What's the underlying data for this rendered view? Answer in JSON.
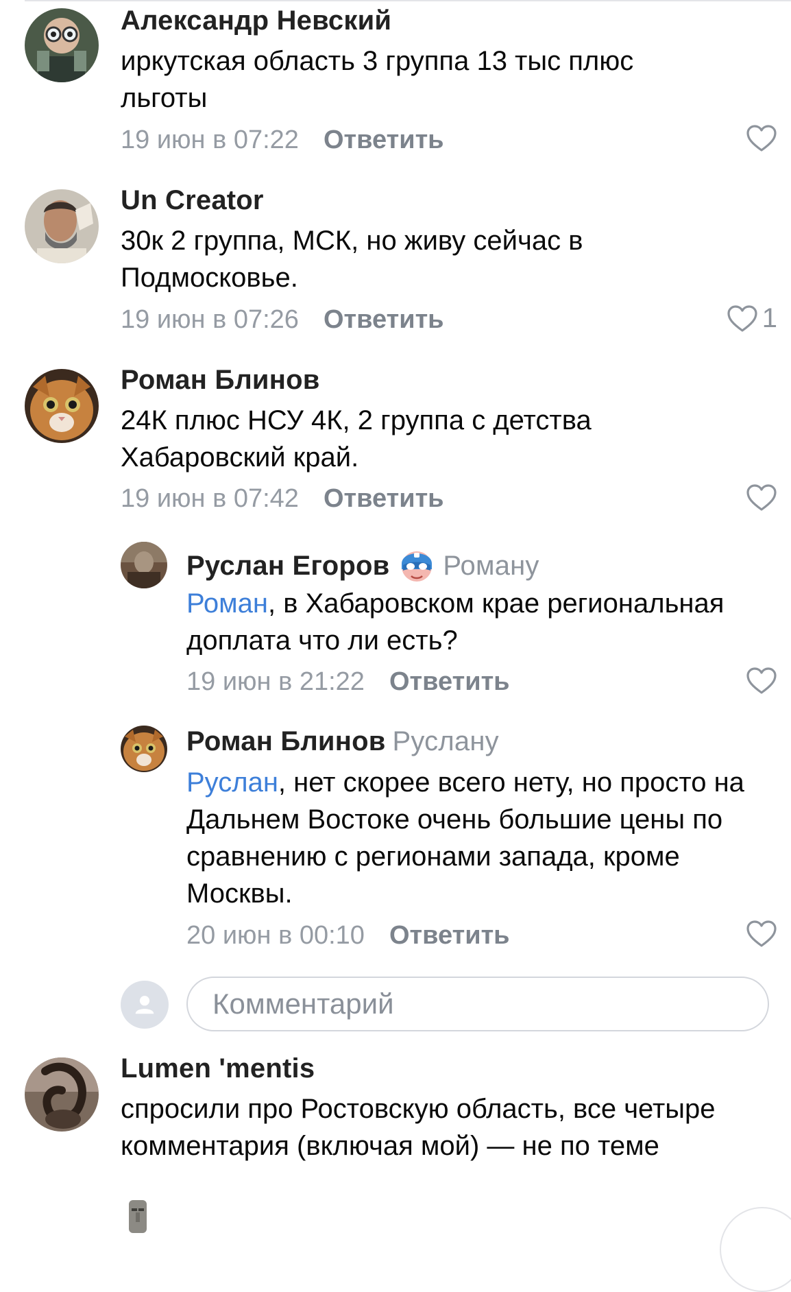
{
  "comments": [
    {
      "author": "Александр Невский",
      "text": "иркутская область 3 группа 13 тыс плюс льготы",
      "time": "19 июн в 07:22",
      "reply_label": "Ответить",
      "likes": ""
    },
    {
      "author": "Un Creator",
      "text": "30к  2 группа, МСК, но живу сейчас в Подмосковье.",
      "time": "19 июн в 07:26",
      "reply_label": "Ответить",
      "likes": "1"
    },
    {
      "author": "Роман Блинов",
      "text": "24К плюс НСУ 4К, 2 группа с детства Хабаровский край.",
      "time": "19 июн в 07:42",
      "reply_label": "Ответить",
      "likes": ""
    }
  ],
  "replies": [
    {
      "author": "Руслан Егоров",
      "addressee": "Роману",
      "mention": "Роман",
      "text": ", в Хабаровском крае региональная доплата что ли есть?",
      "time": "19 июн в 21:22",
      "reply_label": "Ответить"
    },
    {
      "author": "Роман Блинов",
      "addressee": "Руслану",
      "mention": "Руслан",
      "text": ", нет скорее всего нету, но просто на Дальнем Востоке очень большие цены по сравнению с регионами запада, кроме Москвы.",
      "time": "20 июн в 00:10",
      "reply_label": "Ответить"
    }
  ],
  "composer": {
    "placeholder": "Комментарий"
  },
  "last_comment": {
    "author": "Lumen 'mentis",
    "text": "спросили про Ростовскую область, все четыре комментария (включая мой) — не по теме"
  },
  "colors": {
    "link": "#3d7fd9",
    "meta": "#959ba3",
    "reply_button": "#7c838c"
  }
}
